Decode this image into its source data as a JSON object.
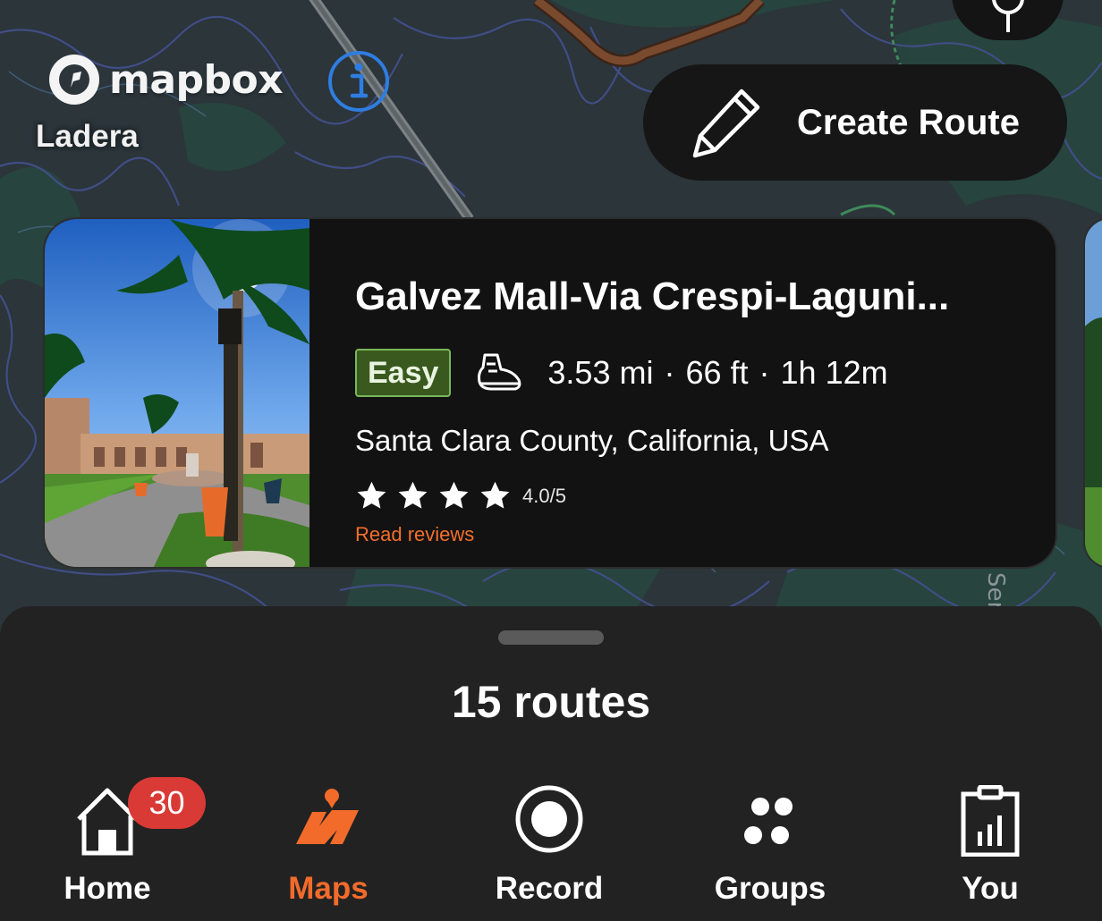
{
  "map": {
    "attribution_logo_text": "mapbox",
    "place_label": "Ladera",
    "icons": [
      "mapbox-logo-icon",
      "info-icon",
      "compass-icon"
    ]
  },
  "create_route": {
    "label": "Create Route",
    "icon": "pencil-icon"
  },
  "route_card": {
    "title": "Galvez Mall-Via Crespi-Laguni...",
    "difficulty": "Easy",
    "activity_icon": "hiking-shoe-icon",
    "distance": "3.53 mi",
    "elevation": "66 ft",
    "duration": "1h 12m",
    "separator": "·",
    "location": "Santa Clara County, California, USA",
    "stars_filled": 4,
    "rating": "4.0/5",
    "reviews_link": "Read reviews"
  },
  "sheet": {
    "routes_count": "15 routes"
  },
  "tabs": [
    {
      "label": "Home",
      "icon": "home-icon",
      "badge": "30",
      "active": false
    },
    {
      "label": "Maps",
      "icon": "maps-icon",
      "active": true
    },
    {
      "label": "Record",
      "icon": "record-icon",
      "active": false
    },
    {
      "label": "Groups",
      "icon": "groups-icon",
      "active": false
    },
    {
      "label": "You",
      "icon": "clipboard-chart-icon",
      "active": false
    }
  ],
  "colors": {
    "accent": "#f26b2b",
    "badge": "#d93a35",
    "difficulty_bg": "#39591f",
    "difficulty_border": "#7ab75b",
    "info_blue": "#2f7de0",
    "card_bg": "#121212",
    "sheet_bg": "#222222"
  }
}
